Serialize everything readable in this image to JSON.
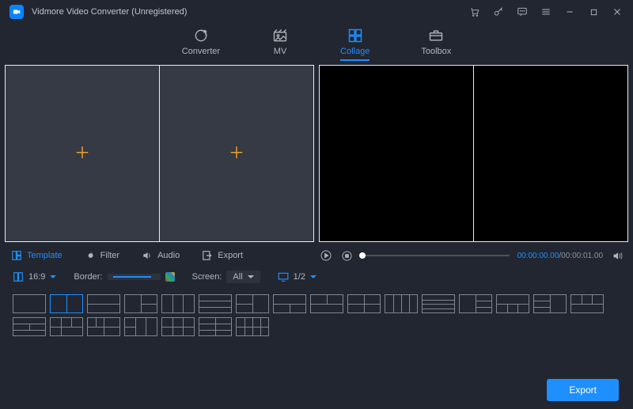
{
  "titlebar": {
    "title": "Vidmore Video Converter (Unregistered)"
  },
  "nav": {
    "converter": "Converter",
    "mv": "MV",
    "collage": "Collage",
    "toolbox": "Toolbox"
  },
  "edit_tabs": {
    "template": "Template",
    "filter": "Filter",
    "audio": "Audio",
    "export": "Export"
  },
  "player": {
    "time_current": "00:00:00.00",
    "time_total": "00:00:01.00"
  },
  "options": {
    "aspect": "16:9",
    "border_label": "Border:",
    "screen_label": "Screen:",
    "screen_value": "All",
    "page": "1/2"
  },
  "footer": {
    "export": "Export"
  }
}
